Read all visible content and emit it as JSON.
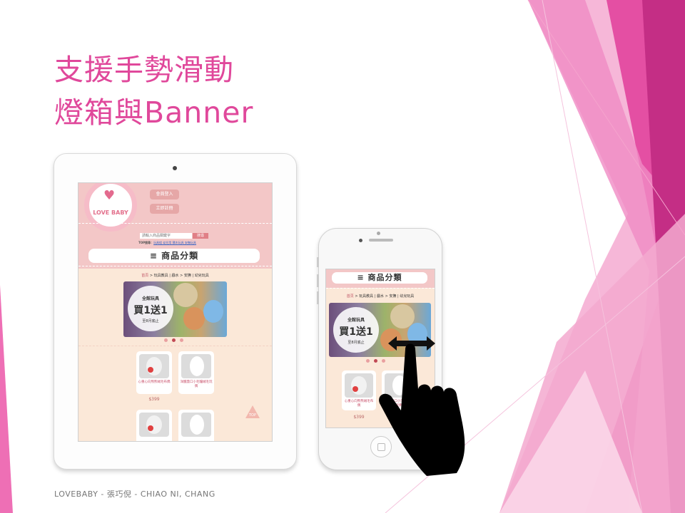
{
  "slide": {
    "title_line1": "支援手勢滑動",
    "title_line2": "燈箱與Banner",
    "footer": "LOVEBABY - 張巧倪 - CHIAO NI, CHANG",
    "accent_color": "#e0489b"
  },
  "site": {
    "logo_text": "LOVE BABY",
    "member_login": "會員登入",
    "register": "立即註冊",
    "search_placeholder": "請輸入商品關鍵字",
    "search_button": "搜尋",
    "top_searches_label": "TOP搜尋：",
    "top_searches_links": "玩具組 幼兒用 積木玩具 安撫玩具",
    "category_bar": "≡ 商品分類",
    "breadcrumb_home": "首頁",
    "breadcrumb_rest": " > 玩具教具 | 戲水 > 安撫 | 幼兒玩具",
    "banner": {
      "small": "全館玩具",
      "big": "買1送1",
      "tiny": "至8月底止"
    },
    "products": [
      {
        "name": "心重心向熊熊絨毛布偶",
        "price": "$399"
      },
      {
        "name": "洋醜蓋口小毛驢絨毛玩偶",
        "price": ""
      },
      {
        "name": "",
        "price": ""
      },
      {
        "name": "",
        "price": ""
      }
    ],
    "top_button": "TOP"
  },
  "phone_site": {
    "category_bar": "≡ 商品分類",
    "breadcrumb_home": "首頁",
    "breadcrumb_rest": " > 玩具教具 | 戲水 > 安撫 | 幼兒玩具",
    "banner": {
      "small": "全館玩具",
      "big": "買1送1",
      "tiny": "至8月底止"
    },
    "products": [
      {
        "name": "心重心向熊熊絨毛布偶",
        "price": "$399"
      },
      {
        "name": "洋醜蓋口小毛驢絨毛玩偶",
        "price": ""
      }
    ]
  },
  "icons": [
    "swipe-hand-icon",
    "swipe-arrow-icon",
    "menu-icon",
    "heart-logo-icon",
    "top-arrow-icon"
  ]
}
